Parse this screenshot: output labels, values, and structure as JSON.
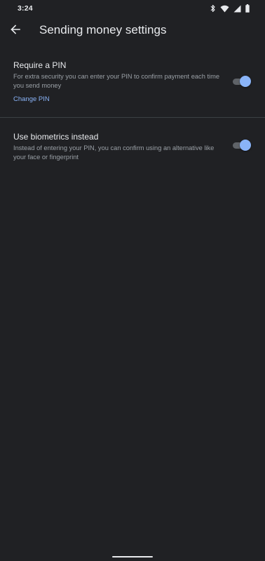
{
  "status_bar": {
    "time": "3:24",
    "icons": [
      "bluetooth-icon",
      "wifi-icon",
      "signal-icon",
      "battery-icon"
    ]
  },
  "app_bar": {
    "back_icon": "arrow-left-icon",
    "title": "Sending money settings"
  },
  "settings": {
    "require_pin": {
      "title": "Require a PIN",
      "description": "For extra security you can enter your PIN to confirm payment each time you send money",
      "link_label": "Change PIN",
      "enabled": true
    },
    "biometrics": {
      "title": "Use biometrics instead",
      "description": "Instead of entering your PIN, you can confirm using an alternative like your face or fingerprint",
      "enabled": true
    }
  },
  "colors": {
    "background": "#202124",
    "text_primary": "#e8eaed",
    "text_secondary": "#9aa0a6",
    "accent": "#8ab4f8",
    "toggle_track": "#5f6368",
    "divider": "#3c4043"
  }
}
